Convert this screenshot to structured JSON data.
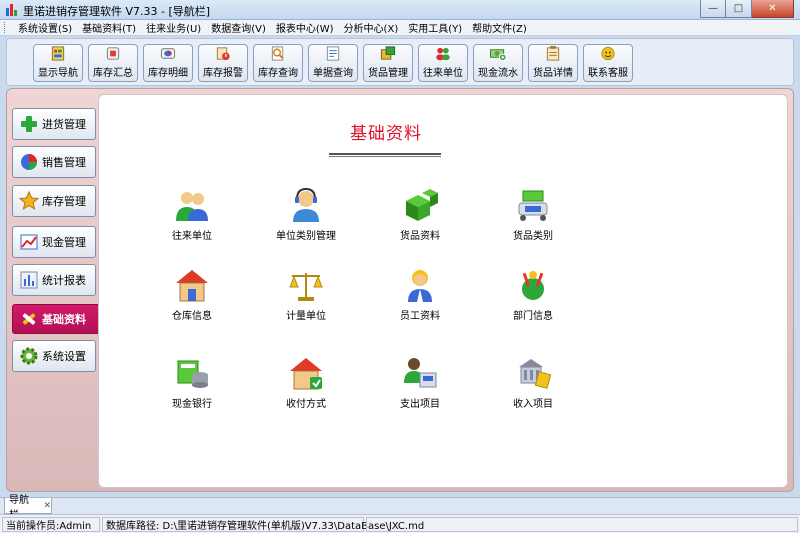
{
  "window": {
    "title": "里诺进销存管理软件 V7.33 - [导航栏]",
    "minimize_glyph": "—",
    "maximize_glyph": "□",
    "close_glyph": "✕"
  },
  "menu": [
    "系统设置(S)",
    "基础资料(T)",
    "往来业务(U)",
    "数据查询(V)",
    "报表中心(W)",
    "分析中心(X)",
    "实用工具(Y)",
    "帮助文件(Z)"
  ],
  "toolbar": [
    {
      "label": "显示导航",
      "icon": "navigation-icon"
    },
    {
      "label": "库存汇总",
      "icon": "stock-summary-icon"
    },
    {
      "label": "库存明细",
      "icon": "stock-detail-icon"
    },
    {
      "label": "库存报警",
      "icon": "stock-alarm-icon"
    },
    {
      "label": "库存查询",
      "icon": "stock-query-icon"
    },
    {
      "label": "单据查询",
      "icon": "document-query-icon"
    },
    {
      "label": "货品管理",
      "icon": "goods-management-icon"
    },
    {
      "label": "往来单位",
      "icon": "partner-icon"
    },
    {
      "label": "现金流水",
      "icon": "cash-flow-icon"
    },
    {
      "label": "货品详情",
      "icon": "goods-detail-icon"
    },
    {
      "label": "联系客服",
      "icon": "customer-service-icon"
    }
  ],
  "nav": [
    {
      "label": "进货管理",
      "icon": "plus-icon",
      "active": false
    },
    {
      "label": "销售管理",
      "icon": "pie-chart-icon",
      "active": false
    },
    {
      "label": "库存管理",
      "icon": "star-icon",
      "active": false
    },
    {
      "label": "现金管理",
      "icon": "money-icon",
      "active": false
    },
    {
      "label": "统计报表",
      "icon": "bar-chart-icon",
      "active": false
    },
    {
      "label": "基础资料",
      "icon": "tools-icon",
      "active": true
    },
    {
      "label": "系统设置",
      "icon": "gear-icon",
      "active": false
    }
  ],
  "content": {
    "title": "基础资料",
    "tiles": [
      {
        "label": "往来单位",
        "icon": "people-icon"
      },
      {
        "label": "单位类别管理",
        "icon": "headset-user-icon"
      },
      {
        "label": "货品资料",
        "icon": "boxes-icon"
      },
      {
        "label": "货品类别",
        "icon": "category-boxes-icon"
      },
      {
        "label": "仓库信息",
        "icon": "warehouse-icon"
      },
      {
        "label": "计量单位",
        "icon": "scale-icon"
      },
      {
        "label": "员工资料",
        "icon": "employee-icon"
      },
      {
        "label": "部门信息",
        "icon": "department-icon"
      },
      {
        "label": "现金银行",
        "icon": "cash-bank-icon"
      },
      {
        "label": "收付方式",
        "icon": "house-payment-icon"
      },
      {
        "label": "支出项目",
        "icon": "expense-icon"
      },
      {
        "label": "收入项目",
        "icon": "income-icon"
      }
    ]
  },
  "tabs": [
    {
      "label": "导航栏",
      "close": "✕"
    }
  ],
  "status": {
    "operator": "当前操作员:Admin",
    "db_path": "数据库路径: D:\\里诺进销存管理软件(单机版)V7.33\\DataBase\\JXC.md"
  }
}
